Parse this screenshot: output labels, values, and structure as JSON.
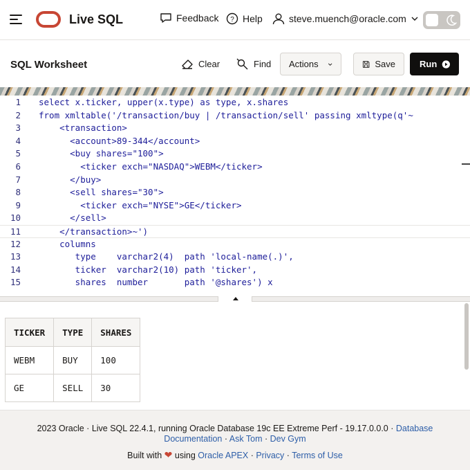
{
  "nav": {
    "app_title": "Live SQL",
    "feedback": "Feedback",
    "help": "Help",
    "user": "steve.muench@oracle.com"
  },
  "toolbar": {
    "title": "SQL Worksheet",
    "clear": "Clear",
    "find": "Find",
    "actions": "Actions",
    "save": "Save",
    "run": "Run"
  },
  "editor": {
    "active_line": 11,
    "lines": [
      {
        "n": "1",
        "text": "select x.ticker, upper(x.type) as type, x.shares"
      },
      {
        "n": "2",
        "text": "from xmltable('/transaction/buy | /transaction/sell' passing xmltype(q'~"
      },
      {
        "n": "3",
        "text": "    <transaction>"
      },
      {
        "n": "4",
        "text": "      <account>89-344</account>"
      },
      {
        "n": "5",
        "text": "      <buy shares=\"100\">"
      },
      {
        "n": "6",
        "text": "        <ticker exch=\"NASDAQ\">WEBM</ticker>"
      },
      {
        "n": "7",
        "text": "      </buy>"
      },
      {
        "n": "8",
        "text": "      <sell shares=\"30\">"
      },
      {
        "n": "9",
        "text": "        <ticker exch=\"NYSE\">GE</ticker>"
      },
      {
        "n": "10",
        "text": "      </sell>"
      },
      {
        "n": "11",
        "text": "    </transaction>~')"
      },
      {
        "n": "12",
        "text": "    columns"
      },
      {
        "n": "13",
        "text": "       type    varchar2(4)  path 'local-name(.)',"
      },
      {
        "n": "14",
        "text": "       ticker  varchar2(10) path 'ticker',"
      },
      {
        "n": "15",
        "text": "       shares  number       path '@shares') x"
      }
    ]
  },
  "results": {
    "columns": [
      "TICKER",
      "TYPE",
      "SHARES"
    ],
    "rows": [
      [
        "WEBM",
        "BUY",
        "100"
      ],
      [
        "GE",
        "SELL",
        "30"
      ]
    ]
  },
  "footer": {
    "line1_text": "2023 Oracle · Live SQL 22.4.1, running Oracle Database 19c EE Extreme Perf - 19.17.0.0.0 · ",
    "line1_link": "Database",
    "line2_link1": "Documentation",
    "line2_sep": " · ",
    "line2_link2": "Ask Tom",
    "line2_link3": "Dev Gym",
    "built_with": "Built with",
    "using": "using",
    "apex_link": "Oracle APEX",
    "privacy_link": "Privacy",
    "terms_link": "Terms of Use",
    "dot": " · "
  },
  "colors": {
    "brand_red": "#c74634",
    "code_blue": "#1d1d99",
    "link_blue": "#2d5ea8",
    "run_button": "#100f0e"
  },
  "icons": [
    "hamburger-icon",
    "oracle-logo",
    "feedback-icon",
    "help-icon",
    "user-icon",
    "chevron-down-icon",
    "moon-icon",
    "eraser-icon",
    "find-icon",
    "save-icon",
    "play-icon",
    "heart-icon"
  ]
}
